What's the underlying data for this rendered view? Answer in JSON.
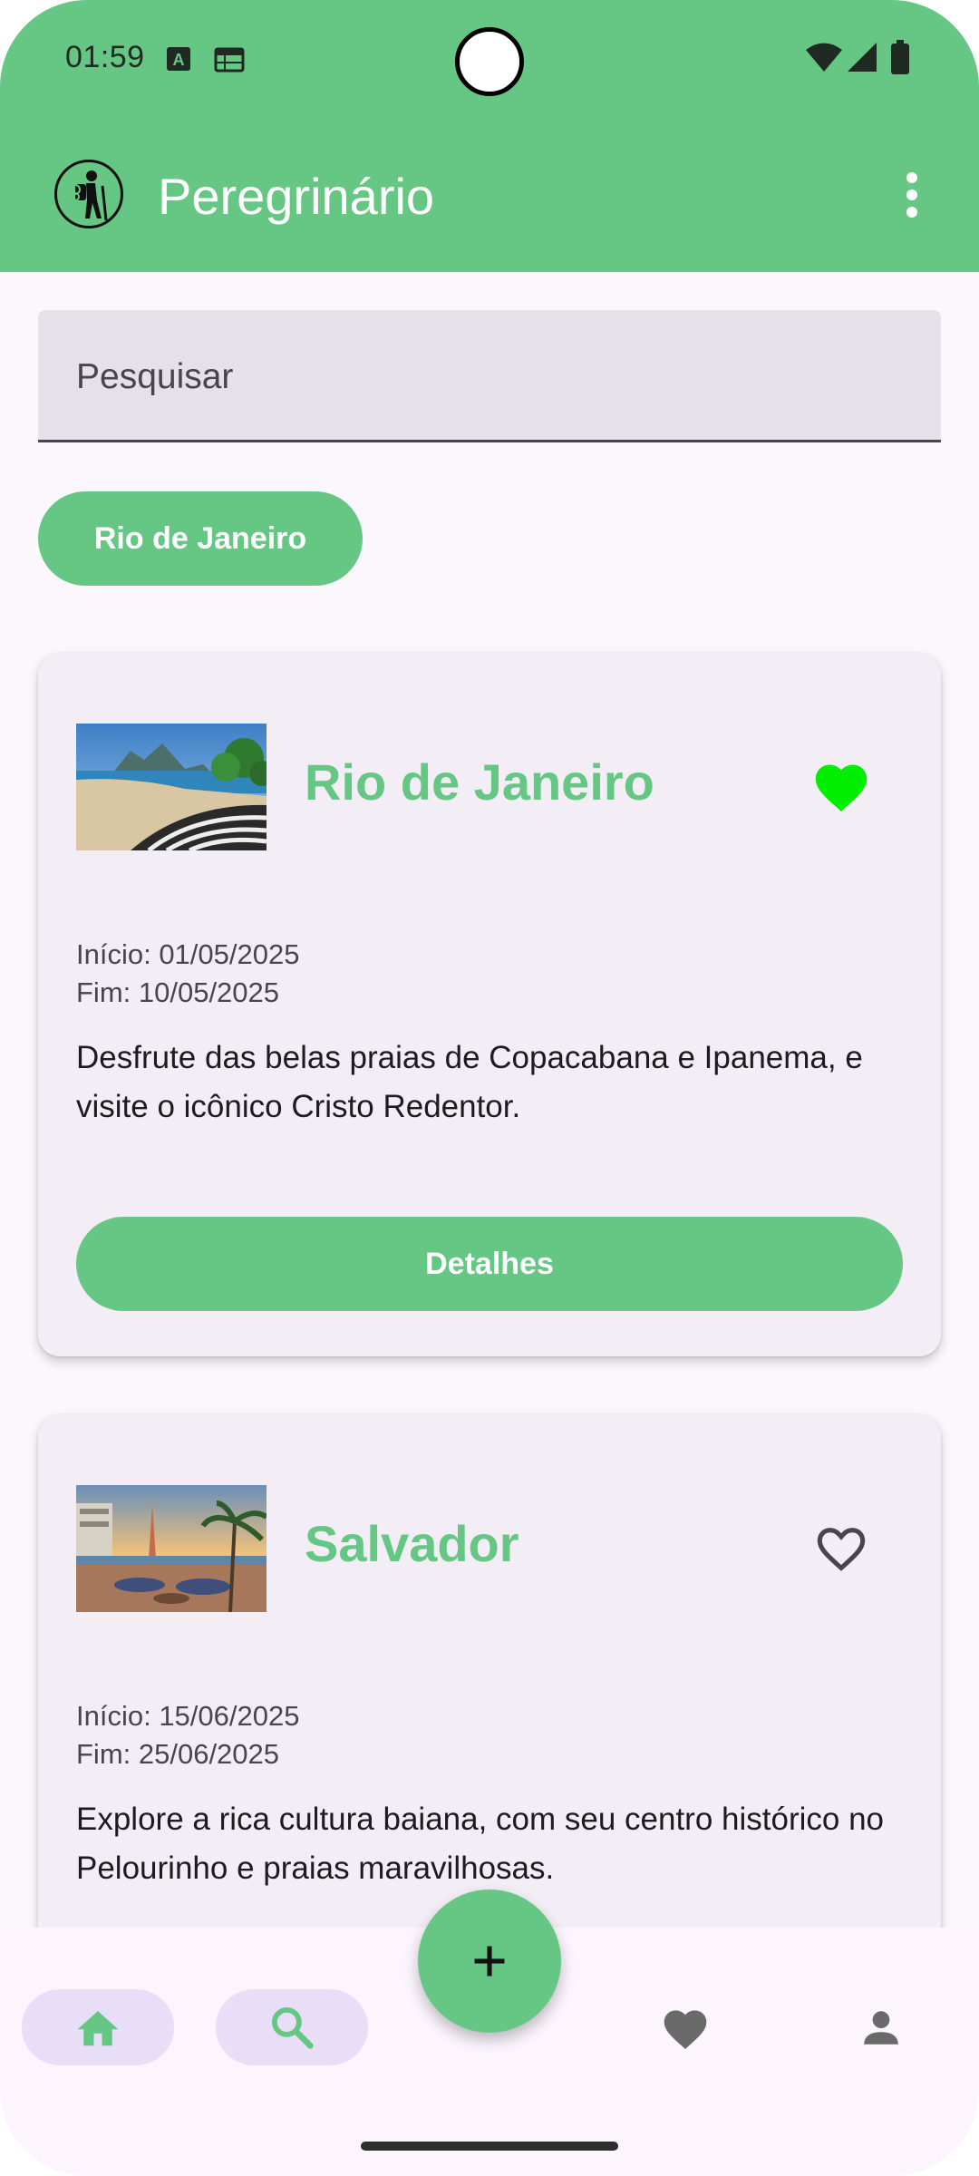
{
  "status_bar": {
    "time": "01:59"
  },
  "app_bar": {
    "title": "Peregrinário"
  },
  "search": {
    "placeholder": "Pesquisar"
  },
  "filter_chip": {
    "label": "Rio de Janeiro"
  },
  "trips": [
    {
      "title": "Rio de Janeiro",
      "favorite": true,
      "start": "Início: 01/05/2025",
      "end": "Fim: 10/05/2025",
      "description": "Desfrute das belas praias de Copacabana e Ipanema, e visite o icônico Cristo Redentor.",
      "button_label": "Detalhes"
    },
    {
      "title": "Salvador",
      "favorite": false,
      "start": "Início: 15/06/2025",
      "end": "Fim: 25/06/2025",
      "description": "Explore a rica cultura baiana, com seu centro histórico no Pelourinho e praias maravilhosas."
    }
  ],
  "bottom_nav": {
    "items": [
      "home-icon",
      "search-icon",
      "heart-icon",
      "person-icon"
    ]
  },
  "colors": {
    "primary": "#66c784",
    "favorite_active": "#00ee00",
    "surface": "#f3edf6",
    "nav_active": "#e8def8"
  }
}
